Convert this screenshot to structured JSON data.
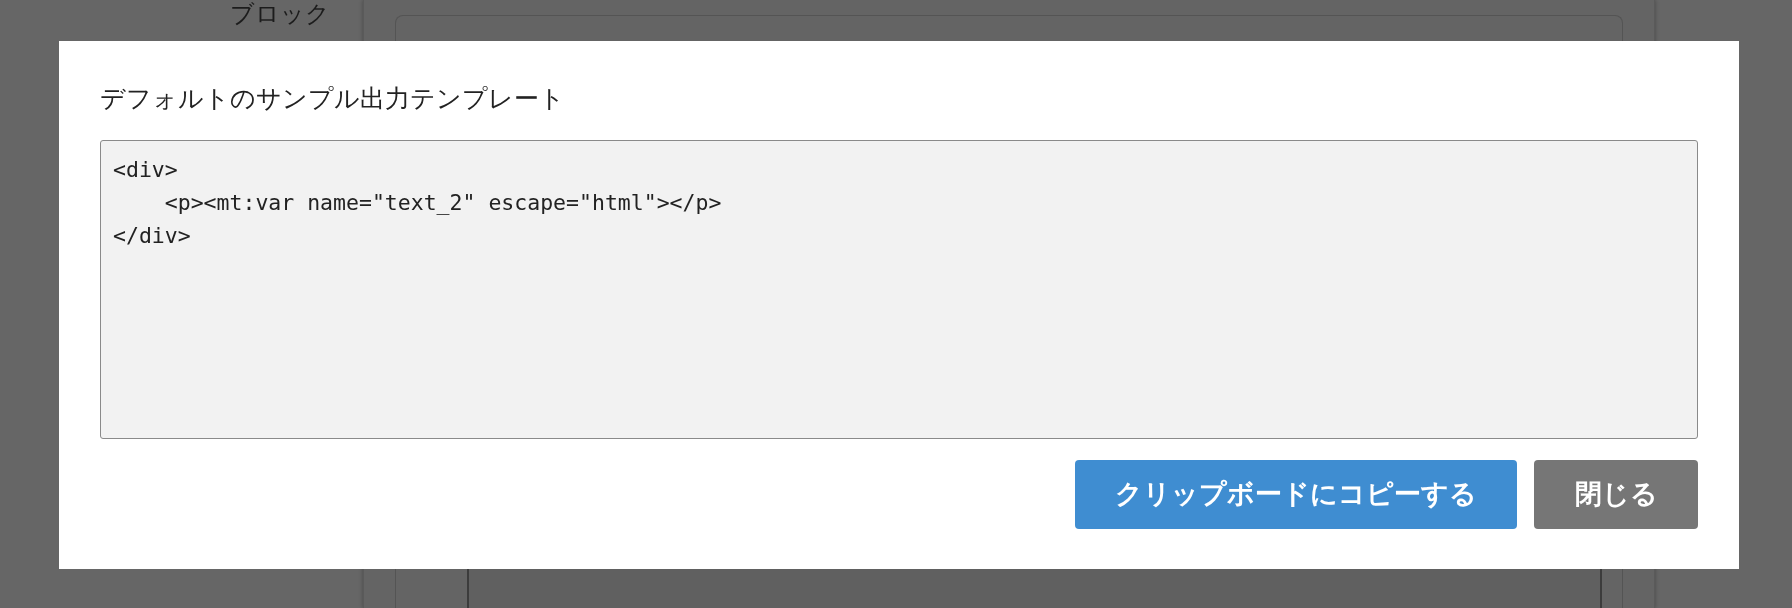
{
  "background": {
    "sidebar_label": "ブロック"
  },
  "dialog": {
    "title": "デフォルトのサンプル出力テンプレート",
    "template": {
      "value": "<div>\n    <p><mt:var name=\"text_2\" escape=\"html\"></p>\n</div>"
    },
    "buttons": [
      {
        "label": "クリップボードにコピーする",
        "kind": "primary"
      },
      {
        "label": "閉じる",
        "kind": "secondary"
      }
    ]
  }
}
